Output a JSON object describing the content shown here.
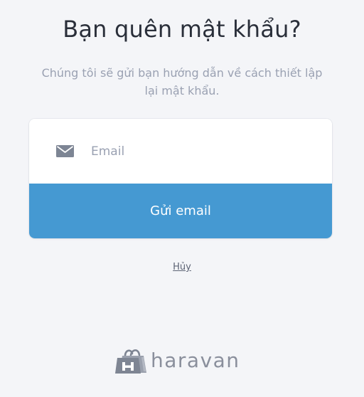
{
  "page": {
    "title": "Bạn quên mật khẩu?",
    "subtitle": "Chúng tôi sẽ gửi bạn hướng dẫn về cách thiết lập lại mật khẩu."
  },
  "form": {
    "email_placeholder": "Email",
    "email_value": "",
    "email_icon": "mail-icon",
    "submit_label": "Gửi email"
  },
  "cancel_label": "Hủy",
  "brand": {
    "name": "haravan",
    "icon": "shopping-bag-icon"
  },
  "colors": {
    "background": "#f4f5f8",
    "accent": "#4599d2",
    "title": "#2a2f3a",
    "muted": "#9aa1b2"
  }
}
